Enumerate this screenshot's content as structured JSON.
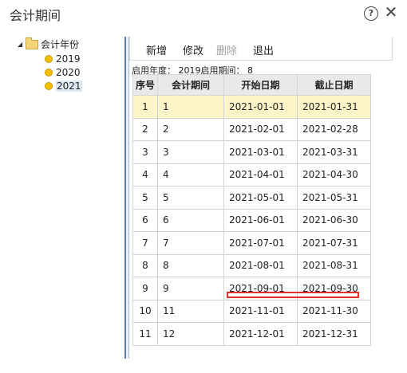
{
  "window": {
    "title": "会计期间",
    "help_glyph": "?",
    "close_glyph": "✕"
  },
  "tree": {
    "root_label": "会计年份",
    "years": [
      "2019",
      "2020",
      "2021"
    ],
    "selected": "2021"
  },
  "toolbar": {
    "add": "新增",
    "edit": "修改",
    "delete": "删除",
    "exit": "退出"
  },
  "info_line": "启用年度： 2019启用期间： 8",
  "table": {
    "headers": [
      "序号",
      "会计期间",
      "开始日期",
      "截止日期"
    ],
    "rows": [
      [
        "1",
        "1",
        "2021-01-01",
        "2021-01-31"
      ],
      [
        "2",
        "2",
        "2021-02-01",
        "2021-02-28"
      ],
      [
        "3",
        "3",
        "2021-03-01",
        "2021-03-31"
      ],
      [
        "4",
        "4",
        "2021-04-01",
        "2021-04-30"
      ],
      [
        "5",
        "5",
        "2021-05-01",
        "2021-05-31"
      ],
      [
        "6",
        "6",
        "2021-06-01",
        "2021-06-30"
      ],
      [
        "7",
        "7",
        "2021-07-01",
        "2021-07-31"
      ],
      [
        "8",
        "8",
        "2021-08-01",
        "2021-08-31"
      ],
      [
        "9",
        "9",
        "2021-09-01",
        "2021-09-30"
      ],
      [
        "10",
        "11",
        "2021-11-01",
        "2021-11-30"
      ],
      [
        "11",
        "12",
        "2021-12-01",
        "2021-12-31"
      ]
    ],
    "current_row": 0
  },
  "colors": {
    "current_row": "#fdf4c8",
    "highlight_box": "#e2312b",
    "splitter": "#5a7bbd"
  }
}
